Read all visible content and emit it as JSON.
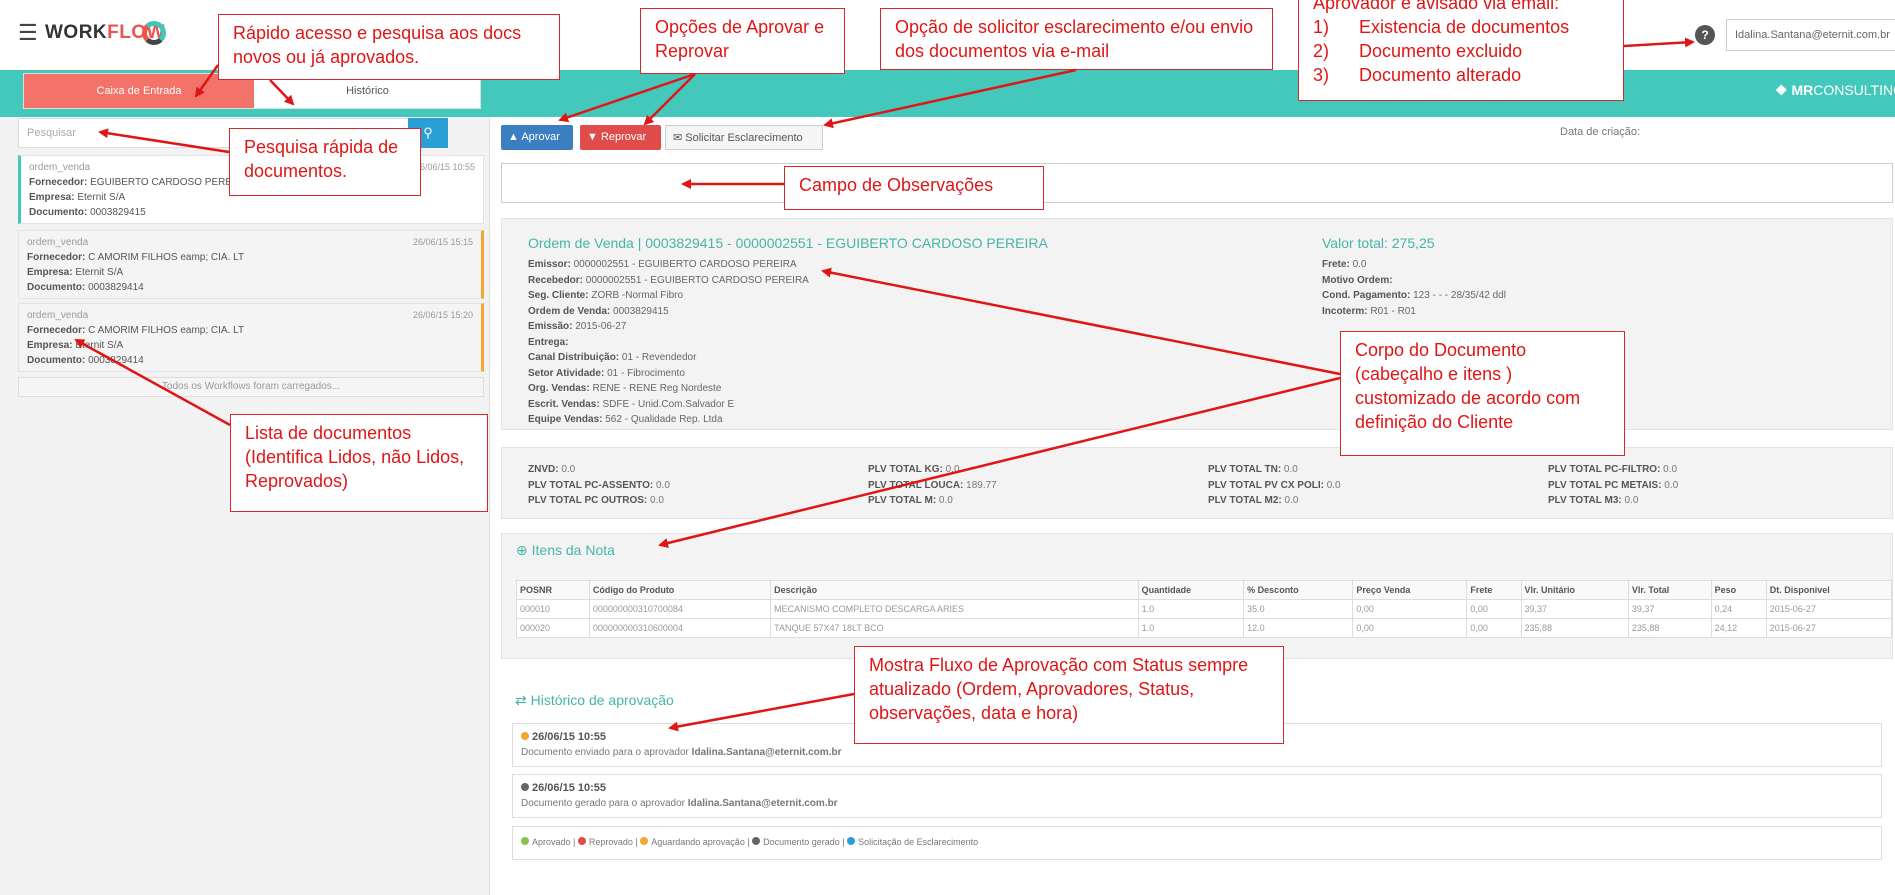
{
  "topbar": {
    "menu_icon": "hamburger-icon",
    "logo_workflow_dark": "WORK",
    "logo_workflow_red": "FLOW",
    "help_icon": "question-icon",
    "user_email": "Idalina.Santana@eternit.com.br"
  },
  "brand_logo": {
    "icon": "mr-logo-icon",
    "bold": "MR",
    "light": "CONSULTING"
  },
  "sidebar": {
    "tabs": [
      "Caixa de Entrada",
      "Histórico"
    ],
    "search_placeholder": "Pesquisar",
    "search_icon": "search-icon",
    "documents": [
      {
        "type": "ordem_venda",
        "date": "26/06/15 10:55",
        "fornecedor_label": "Fornecedor:",
        "fornecedor": "EGUIBERTO CARDOSO PEREIRA",
        "empresa_label": "Empresa:",
        "empresa": "Eternit S/A",
        "documento_label": "Documento:",
        "documento": "0003829415"
      },
      {
        "type": "ordem_venda",
        "date": "26/06/15 15:15",
        "fornecedor_label": "Fornecedor:",
        "fornecedor": "C AMORIM FILHOS eamp; CIA. LT",
        "empresa_label": "Empresa:",
        "empresa": "Eternit S/A",
        "documento_label": "Documento:",
        "documento": "0003829414"
      },
      {
        "type": "ordem_venda",
        "date": "26/06/15 15:20",
        "fornecedor_label": "Fornecedor:",
        "fornecedor": "C AMORIM FILHOS eamp; CIA. LT",
        "empresa_label": "Empresa:",
        "empresa": "Eternit S/A",
        "documento_label": "Documento:",
        "documento": "0003829414"
      }
    ],
    "loaded_text": "Todos os Workflows foram carregados..."
  },
  "actions": {
    "approve": "Aprovar",
    "approve_icon": "thumbs-up-icon",
    "reject": "Reprovar",
    "reject_icon": "thumbs-down-icon",
    "clarify": "Solicitar Esclarecimento",
    "clarify_icon": "envelope-icon",
    "created_label": "Data de criação:"
  },
  "document": {
    "title": "Ordem de Venda | 0003829415 - 0000002551 - EGUIBERTO CARDOSO PEREIRA",
    "total_title": "Valor total: 275,25",
    "fields_left": [
      {
        "label": "Emissor:",
        "value": "0000002551 - EGUIBERTO CARDOSO PEREIRA"
      },
      {
        "label": "Recebedor:",
        "value": "0000002551 - EGUIBERTO CARDOSO PEREIRA"
      },
      {
        "label": "Seg. Cliente:",
        "value": "ZORB -Normal Fibro"
      },
      {
        "label": "Ordem de Venda:",
        "value": "0003829415"
      },
      {
        "label": "Emissão:",
        "value": "2015-06-27"
      },
      {
        "label": "Entrega:",
        "value": ""
      },
      {
        "label": "Canal Distribuição:",
        "value": "01 - Revendedor"
      },
      {
        "label": "Setor Atividade:",
        "value": "01 - Fibrocimento"
      },
      {
        "label": "Org. Vendas:",
        "value": "RENE - RENE Reg Nordeste"
      },
      {
        "label": "Escrit. Vendas:",
        "value": "SDFE - Unid.Com.Salvador E"
      },
      {
        "label": "Equipe Vendas:",
        "value": "562 - Qualidade Rep. Ltda"
      }
    ],
    "fields_right": [
      {
        "label": "Frete:",
        "value": "0.0"
      },
      {
        "label": "Motivo Ordem:",
        "value": ""
      },
      {
        "label": "Cond. Pagamento:",
        "value": "123 - - - 28/35/42 ddl"
      },
      {
        "label": "Incoterm:",
        "value": "R01 - R01"
      }
    ]
  },
  "totals": [
    [
      {
        "label": "ZNVD:",
        "value": "0.0"
      },
      {
        "label": "PLV TOTAL PC-ASSENTO:",
        "value": "0.0"
      },
      {
        "label": "PLV TOTAL PC OUTROS:",
        "value": "0.0"
      }
    ],
    [
      {
        "label": "PLV TOTAL KG:",
        "value": "0.0"
      },
      {
        "label": "PLV TOTAL LOUCA:",
        "value": "189.77"
      },
      {
        "label": "PLV TOTAL M:",
        "value": "0.0"
      }
    ],
    [
      {
        "label": "PLV TOTAL TN:",
        "value": "0.0"
      },
      {
        "label": "PLV TOTAL PV CX POLI:",
        "value": "0.0"
      },
      {
        "label": "PLV TOTAL M2:",
        "value": "0.0"
      }
    ],
    [
      {
        "label": "PLV TOTAL PC-FILTRO:",
        "value": "0.0"
      },
      {
        "label": "PLV TOTAL PC METAIS:",
        "value": "0.0"
      },
      {
        "label": "PLV TOTAL M3:",
        "value": "0.0"
      }
    ]
  ],
  "items": {
    "title": "Itens da Nota",
    "icon": "plus-circle-icon",
    "columns": [
      "POSNR",
      "Código do Produto",
      "Descrição",
      "Quantidade",
      "% Desconto",
      "Preço Venda",
      "Frete",
      "Vlr. Unitário",
      "Vlr. Total",
      "Peso",
      "Dt. Disponivel"
    ],
    "rows": [
      [
        "000010",
        "000000000310700084",
        "MECANISMO COMPLETO DESCARGA ARIES",
        "1.0",
        "35.0",
        "0,00",
        "0,00",
        "39,37",
        "39,37",
        "0,24",
        "2015-06-27"
      ],
      [
        "000020",
        "000000000310600004",
        "TANQUE 57X47 18LT BCO",
        "1.0",
        "12.0",
        "0,00",
        "0,00",
        "235,88",
        "235,88",
        "24,12",
        "2015-06-27"
      ]
    ]
  },
  "history": {
    "title": "Histórico de aprovação",
    "icon": "exchange-icon",
    "entries": [
      {
        "date": "26/06/15 10:55",
        "text": "Documento enviado para o aprovador",
        "user": "Idalina.Santana@eternit.com.br",
        "color": "#f0a830"
      },
      {
        "date": "26/06/15 10:55",
        "text": "Documento gerado para o aprovador",
        "user": "Idalina.Santana@eternit.com.br",
        "color": "#666666"
      }
    ],
    "legend": [
      {
        "label": "Aprovado",
        "color": "#8cc152"
      },
      {
        "label": "Reprovado",
        "color": "#e04b4b"
      },
      {
        "label": "Aguardando aprovação",
        "color": "#f0a830"
      },
      {
        "label": "Documento gerado",
        "color": "#666666"
      },
      {
        "label": "Solicitação de Esclarecimento",
        "color": "#2a9fd6"
      }
    ]
  },
  "annotations": {
    "quick_access": "Rápido acesso e pesquisa aos docs novos ou já aprovados.",
    "approve_reject": "Opções de Aprovar e Reprovar",
    "clarify": "Opção de solicitor esclarecimento e/ou envio dos documentos via e-mail",
    "notify_title": "Aprovador é avisado via email:",
    "notify_items": [
      "1)      Existencia de documentos",
      "2)      Documento excluido",
      "3)      Documento alterado"
    ],
    "quick_search": "Pesquisa rápida de documentos.",
    "observations": "Campo de Observações",
    "doc_body": "Corpo do Documento (cabeçalho e itens ) customizado de acordo com definição do Cliente",
    "doc_list": "Lista de documentos (Identifica Lidos, não Lidos, Reprovados)",
    "flow": "Mostra Fluxo de Aprovação com Status sempre atualizado (Ordem, Aprovadores, Status, observações, data e hora)"
  }
}
